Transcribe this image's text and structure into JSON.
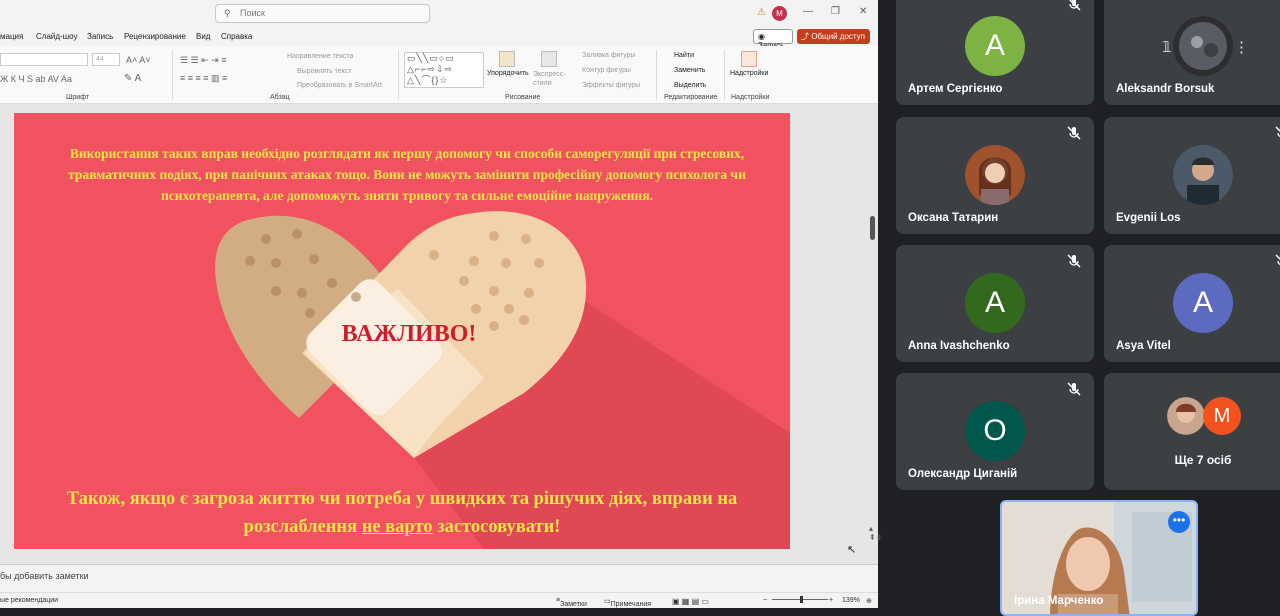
{
  "powerpoint": {
    "search_placeholder": "Поиск",
    "account_initial": "M",
    "menu": [
      "мация",
      "Слайд-шоу",
      "Запись",
      "Рецензирование",
      "Вид",
      "Справка"
    ],
    "record_button": "Запись",
    "share_button": "Общий доступ",
    "ribbon": {
      "groups": [
        "Шрифт",
        "Абзац",
        "Рисование",
        "Редактирование",
        "Надстройки"
      ],
      "font_size": "44",
      "text_direction": "Направление текста",
      "align_text": "Выровнять текст",
      "convert_smartart": "Преобразовать в SmartArt",
      "arrange": "Упорядочить",
      "quick_styles": "Экспресс-стили",
      "shape_fill": "Заливка фигуры",
      "shape_outline": "Контур фигуры",
      "shape_effects": "Эффекты фигуры",
      "find": "Найти",
      "replace": "Заменить",
      "select": "Выделить",
      "addins": "Надстройки"
    },
    "slide": {
      "top_text": "Використання таких вправ необхідно розглядати як першу допомогу чи способи саморегуляції при стресових, травматичних подіях, при панічних атаках тощо. Вони не можуть замінити професійну допомогу психолога чи психотерапевта, але допоможуть зняти тривогу та сильне емоційне напруження.",
      "center_label": "ВАЖЛИВО!",
      "bottom_text_before": "Також, якщо є загроза життю чи потреба у швидких та рішучих діях, вправи на розслаблення ",
      "bottom_text_underlined": "не варто",
      "bottom_text_after": " застосовувати!",
      "colors": {
        "background": "#f0535f",
        "text": "#f4e34a",
        "label": "#c8202c"
      }
    },
    "notes_placeholder": "бы добавить заметки",
    "status": {
      "left": "ые рекомендации",
      "notes_label": "Заметки",
      "comments_label": "Примечания",
      "zoom": "139%"
    }
  },
  "meet": {
    "participants": [
      {
        "name": "Артем Сергієнко",
        "initial": "А",
        "color": "#7cb342",
        "type": "initial",
        "muted": true
      },
      {
        "name": "Aleksandr Borsuk",
        "type": "photo",
        "muted": false
      },
      {
        "name": "Оксана Татарин",
        "type": "photo",
        "muted": true
      },
      {
        "name": "Evgenii Los",
        "type": "photo",
        "muted": true
      },
      {
        "name": "Anna Ivashchenko",
        "initial": "A",
        "color": "#33691e",
        "type": "initial",
        "muted": true
      },
      {
        "name": "Asya Vitel",
        "initial": "A",
        "color": "#5c6bc0",
        "type": "initial",
        "muted": true
      },
      {
        "name": "Олександр Циганій",
        "initial": "О",
        "color": "#00574b",
        "type": "initial",
        "muted": true
      }
    ],
    "more": {
      "label": "Ще 7 осіб",
      "initial": "M",
      "color": "#f4511e"
    },
    "self": {
      "name": "Ірина Марченко"
    }
  }
}
